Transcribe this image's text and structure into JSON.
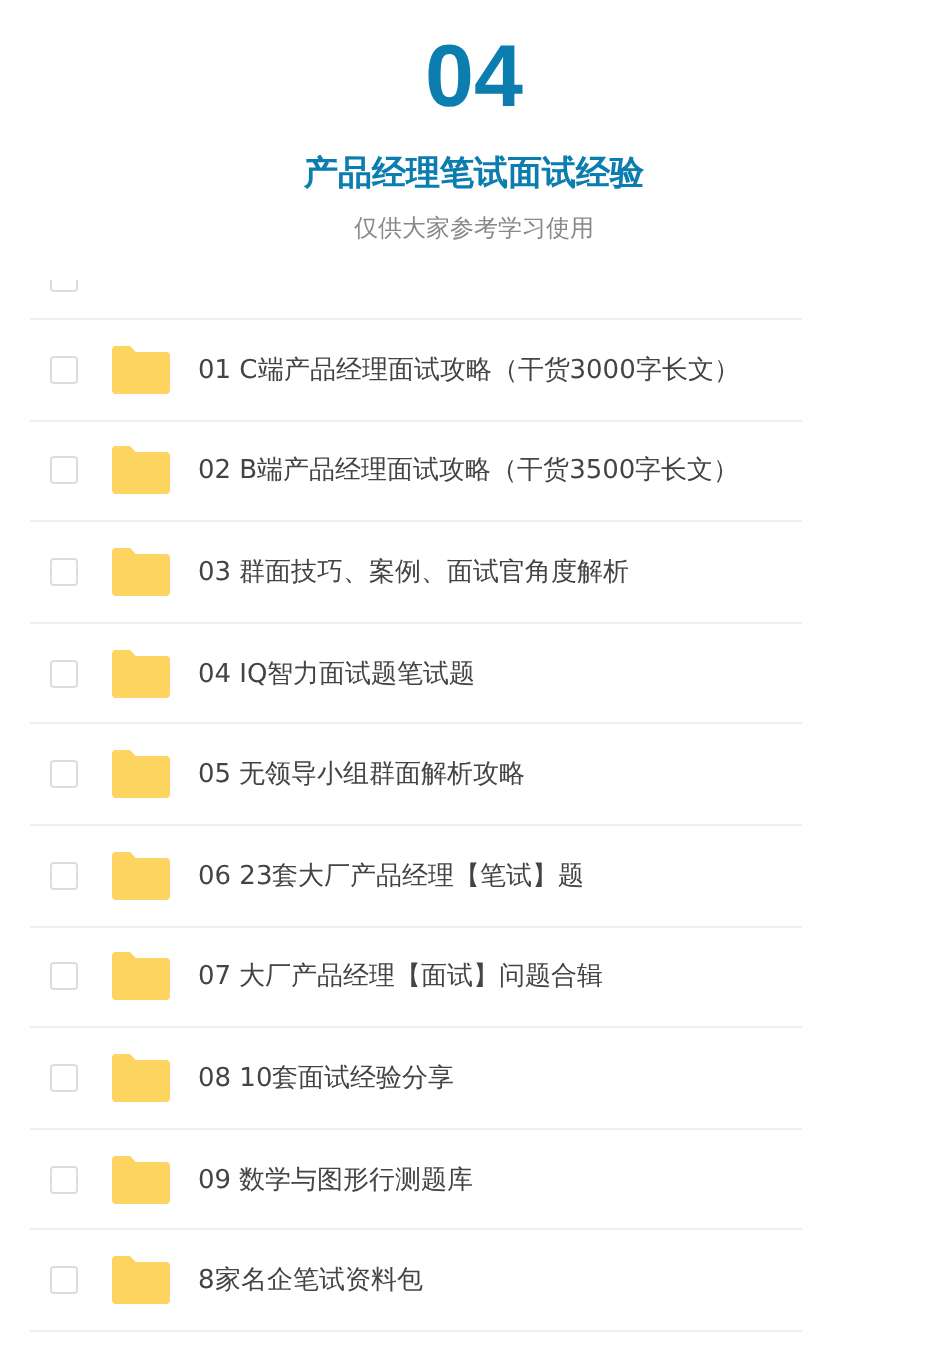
{
  "header": {
    "number": "04",
    "title": "产品经理笔试面试经验",
    "subtitle": "仅供大家参考学习使用"
  },
  "partial_row": {
    "checked": false
  },
  "folders": [
    {
      "name": "01 C端产品经理面试攻略（干货3000字长文）",
      "checked": false
    },
    {
      "name": "02 B端产品经理面试攻略（干货3500字长文）",
      "checked": false
    },
    {
      "name": "03 群面技巧、案例、面试官角度解析",
      "checked": false
    },
    {
      "name": "04 IQ智力面试题笔试题",
      "checked": false
    },
    {
      "name": "05 无领导小组群面解析攻略",
      "checked": false
    },
    {
      "name": "06 23套大厂产品经理【笔试】题",
      "checked": false
    },
    {
      "name": "07 大厂产品经理【面试】问题合辑",
      "checked": false
    },
    {
      "name": "08 10套面试经验分享",
      "checked": false
    },
    {
      "name": "09 数学与图形行测题库",
      "checked": false
    },
    {
      "name": "8家名企笔试资料包",
      "checked": false
    }
  ]
}
